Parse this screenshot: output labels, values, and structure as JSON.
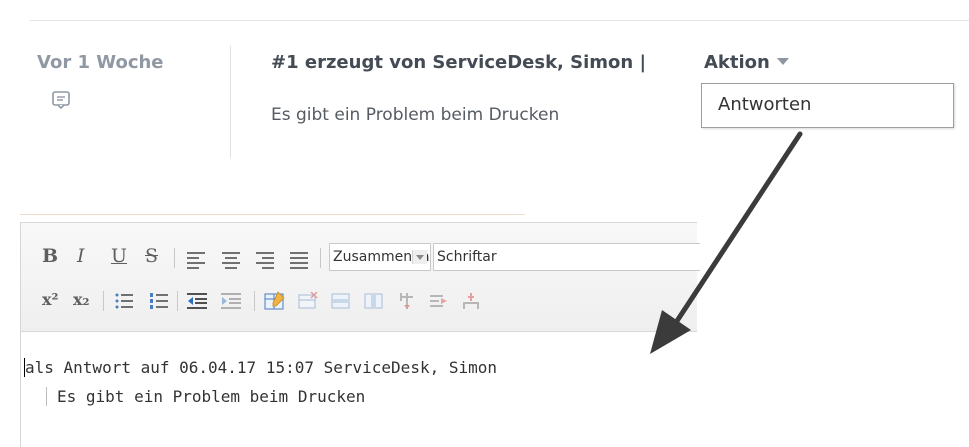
{
  "timeline": {
    "time_label": "Vor 1 Woche",
    "icon": "comment-icon"
  },
  "entry": {
    "title": "#1 erzeugt von ServiceDesk, Simon",
    "separator": "|",
    "action_label": "Aktion",
    "body": "Es gibt ein Problem beim Drucken"
  },
  "dropdown": {
    "items": [
      "Antworten"
    ]
  },
  "editor": {
    "toolbar": {
      "bold": "B",
      "italic": "I",
      "underline": "U",
      "strike": "S",
      "style_select": "Zusammenhäng",
      "font_select": "Schriftar",
      "superscript": "x²",
      "subscript": "x₂"
    },
    "reply_header": "als Antwort auf 06.04.17 15:07 ServiceDesk, Simon",
    "quoted_text": "Es gibt ein Problem beim Drucken"
  },
  "colors": {
    "arrow": "#3b3b3b",
    "muted_text": "#8f98a3",
    "title_text": "#444b54"
  }
}
